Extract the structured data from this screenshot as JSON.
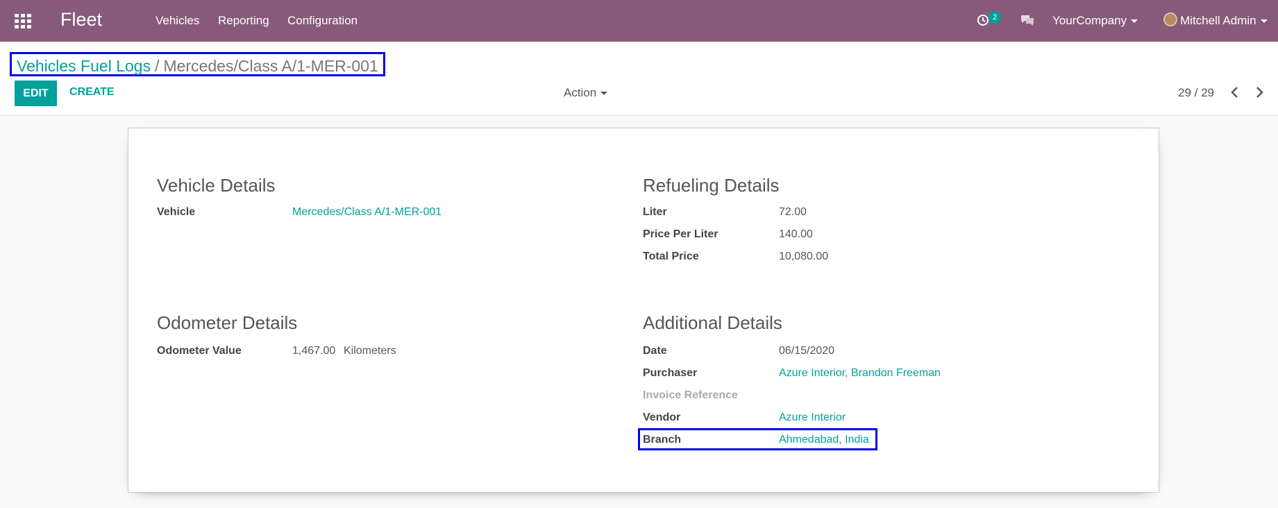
{
  "navbar": {
    "app_name": "Fleet",
    "menu": [
      "Vehicles",
      "Reporting",
      "Configuration"
    ],
    "activity_count": "2",
    "company": "YourCompany",
    "user": "Mitchell Admin",
    "color": "#875a7b"
  },
  "breadcrumb": {
    "parent": "Vehicles Fuel Logs",
    "separator": "/",
    "current": "Mercedes/Class A/1-MER-001"
  },
  "toolbar": {
    "edit_label": "EDIT",
    "create_label": "CREATE",
    "action_label": "Action",
    "pager": "29 / 29"
  },
  "form": {
    "vehicle_details": {
      "title": "Vehicle Details",
      "vehicle_label": "Vehicle",
      "vehicle_value": "Mercedes/Class A/1-MER-001"
    },
    "refueling_details": {
      "title": "Refueling Details",
      "liter_label": "Liter",
      "liter_value": "72.00",
      "price_label": "Price Per Liter",
      "price_value": "140.00",
      "total_label": "Total Price",
      "total_value": "10,080.00"
    },
    "odometer_details": {
      "title": "Odometer Details",
      "odometer_label": "Odometer Value",
      "odometer_value": "1,467.00",
      "odometer_unit": "Kilometers"
    },
    "additional_details": {
      "title": "Additional Details",
      "date_label": "Date",
      "date_value": "06/15/2020",
      "purchaser_label": "Purchaser",
      "purchaser_value": "Azure Interior, Brandon Freeman",
      "invoice_label": "Invoice Reference",
      "vendor_label": "Vendor",
      "vendor_value": "Azure Interior",
      "branch_label": "Branch",
      "branch_value": "Ahmedabad, India"
    }
  },
  "colors": {
    "accent": "#00a09d",
    "highlight": "#0000ee"
  }
}
